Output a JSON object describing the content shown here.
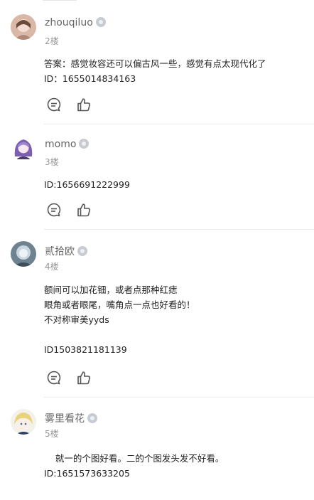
{
  "comments": [
    {
      "username": "zhouqiluo",
      "floor": "2楼",
      "text": "答案：感觉妆容还可以偏古风一些，感觉有点太现代化了\nID：1655014834163"
    },
    {
      "username": "momo",
      "floor": "3楼",
      "text": "ID:1656691222999"
    },
    {
      "username": "贰拾欧",
      "floor": "4楼",
      "text": "额间可以加花钿，或者点那种红痣\n眼角或者眼尾，嘴角点一点也好看的！\n不对称审美yyds\n\nID1503821181139"
    },
    {
      "username": "雾里看花",
      "floor": "5楼",
      "text": "    就一的个图好看。二的个图发头发不好看。\nID:1651573633205"
    }
  ],
  "icons": {
    "level": "level-badge-icon",
    "reply": "reply-bubble-icon",
    "like": "thumbs-up-icon"
  },
  "colors": {
    "username": "#666666",
    "floor": "#999999",
    "icon": "#555555",
    "divider": "#ececec"
  }
}
